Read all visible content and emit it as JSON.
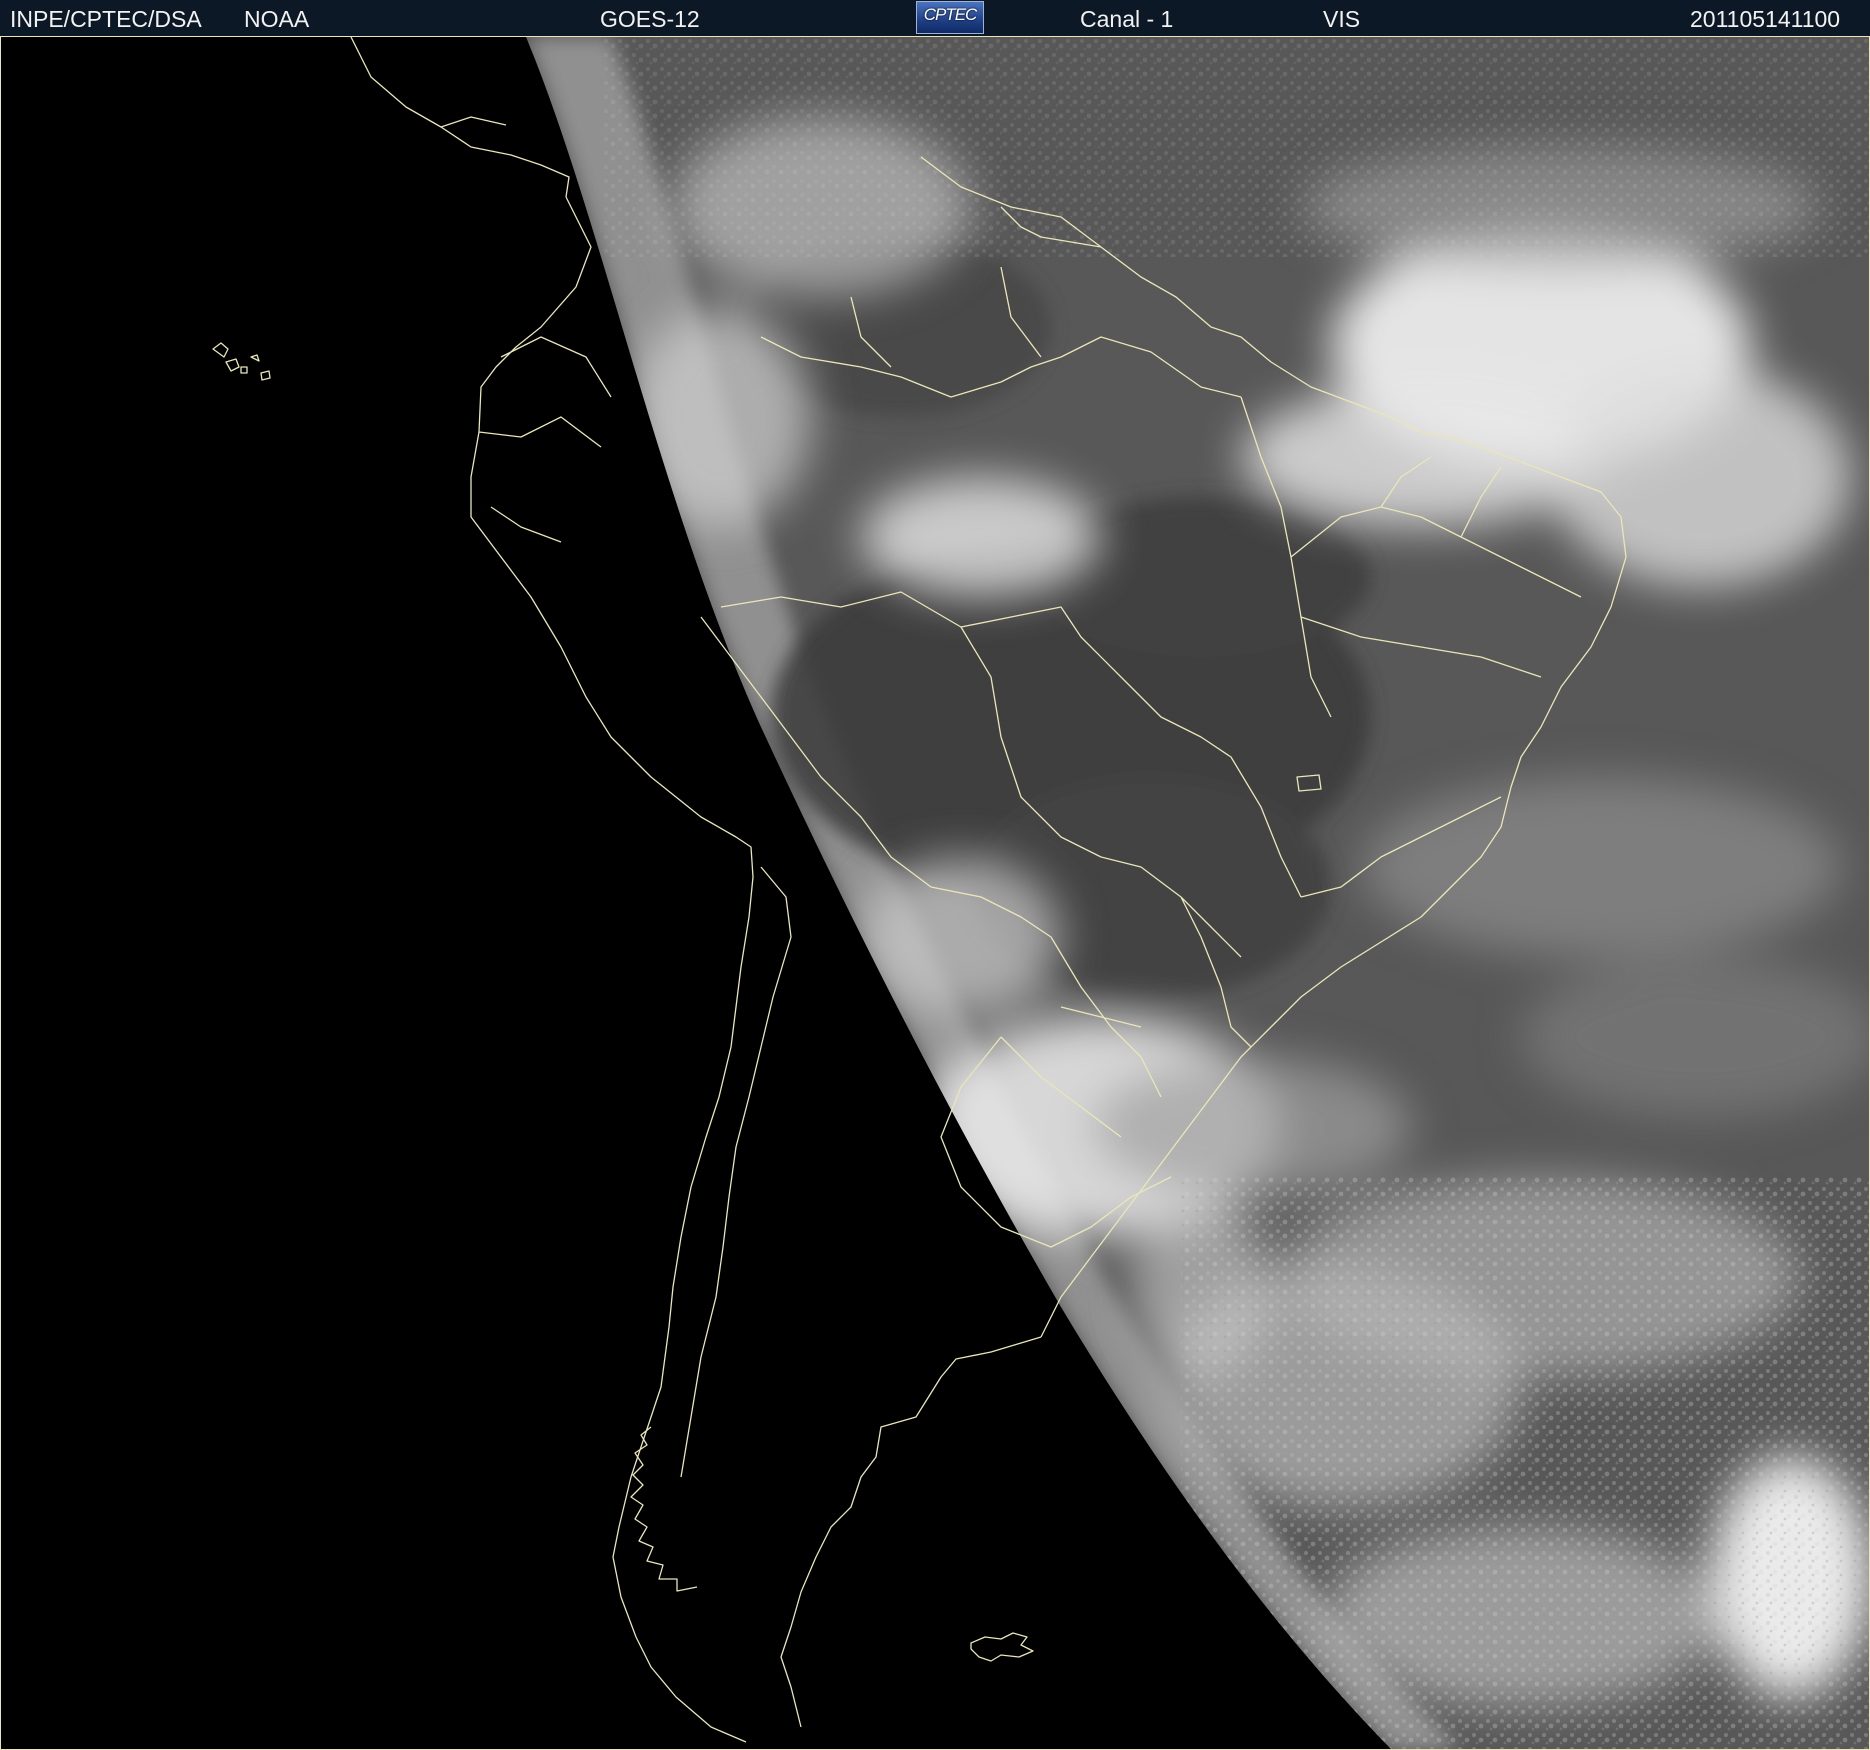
{
  "header": {
    "institution": "INPE/CPTEC/DSA",
    "agency": "NOAA",
    "satellite": "GOES-12",
    "logo_text": "CPTEC",
    "channel": "Canal - 1",
    "band": "VIS",
    "timestamp": "201105141100"
  },
  "map": {
    "region": "South America",
    "space_color": "#000000",
    "border_color": "#e9e6b8",
    "cloud_color": "#ffffff",
    "land_color": "#3a3a3a"
  }
}
